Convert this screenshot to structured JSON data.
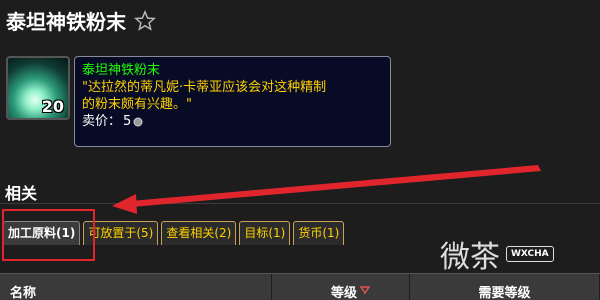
{
  "page": {
    "title": "泰坦神铁粉末"
  },
  "item": {
    "icon": "titansteel-powder-icon",
    "count": "20",
    "tooltip": {
      "name": "泰坦神铁粉末",
      "desc_line1": "\"达拉然的蒂凡妮·卡蒂亚应该会对这种精制",
      "desc_line2": "的粉末颇有兴趣。\"",
      "price_label": "卖价：",
      "price_value": "5"
    }
  },
  "related": {
    "title": "相关",
    "tabs": [
      {
        "label": "加工原料(1)",
        "active": true
      },
      {
        "label": "可放置于(5)"
      },
      {
        "label": "查看相关(2)"
      },
      {
        "label": "目标(1)"
      },
      {
        "label": "货币(1)"
      }
    ]
  },
  "table": {
    "columns": [
      "名称",
      "等级",
      "需要等级"
    ]
  },
  "watermark": {
    "text": "微茶",
    "badge": "WXCHA"
  },
  "colors": {
    "highlight": "#e0262c",
    "item_name": "#1eff00",
    "item_desc": "#ffd100",
    "tab_text": "#ffd100"
  }
}
